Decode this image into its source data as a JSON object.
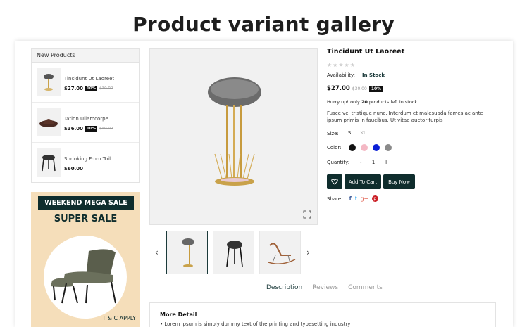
{
  "banner": {
    "title": "Product variant gallery"
  },
  "new_products": {
    "heading": "New Products",
    "items": [
      {
        "name": "Tincidunt Ut Laoreet",
        "price": "$27.00",
        "badge": "10%",
        "old_price": "$30.00"
      },
      {
        "name": "Tation Ullamcorpe",
        "price": "$36.00",
        "badge": "10%",
        "old_price": "$40.00"
      },
      {
        "name": "Shrinking From Toil",
        "price": "$60.00"
      }
    ]
  },
  "promo": {
    "bar": "WEEKEND MEGA SALE",
    "headline": "SUPER SALE",
    "link": "T & C APPLY"
  },
  "product": {
    "title": "Tincidunt Ut Laoreet",
    "stars": "★★★★★",
    "availability_label": "Availability:",
    "availability_value": "In Stock",
    "price": "$27.00",
    "old_price": "$30.00",
    "badge": "10%",
    "stock_pre": "Hurry up! only ",
    "stock_count": "20",
    "stock_post": " products left in stock!",
    "description": "Fusce vel tristique nunc. Interdum et malesuada fames ac ante ipsum primis in faucibus. Ut vitae auctor turpis",
    "size_label": "Size:",
    "sizes": [
      "S",
      "XL"
    ],
    "color_label": "Color:",
    "colors": [
      "#111111",
      "#f4b8c4",
      "#0a1fd6",
      "#8a8a8a"
    ],
    "quantity_label": "Quantity:",
    "quantity": "1",
    "minus": "-",
    "plus": "+",
    "add_to_cart": "Add To Cart",
    "buy_now": "Buy Now",
    "share_label": "Share:",
    "share_icons": [
      "f",
      "t",
      "g+",
      "p"
    ]
  },
  "tabs": [
    "Description",
    "Reviews",
    "Comments"
  ],
  "detail": {
    "title": "More Detail",
    "text": "• Lorem Ipsum is simply dummy text of the printing and typesetting industry"
  },
  "colors": {
    "accent": "#0f2d2d",
    "promo_bg": "#f5deba"
  }
}
